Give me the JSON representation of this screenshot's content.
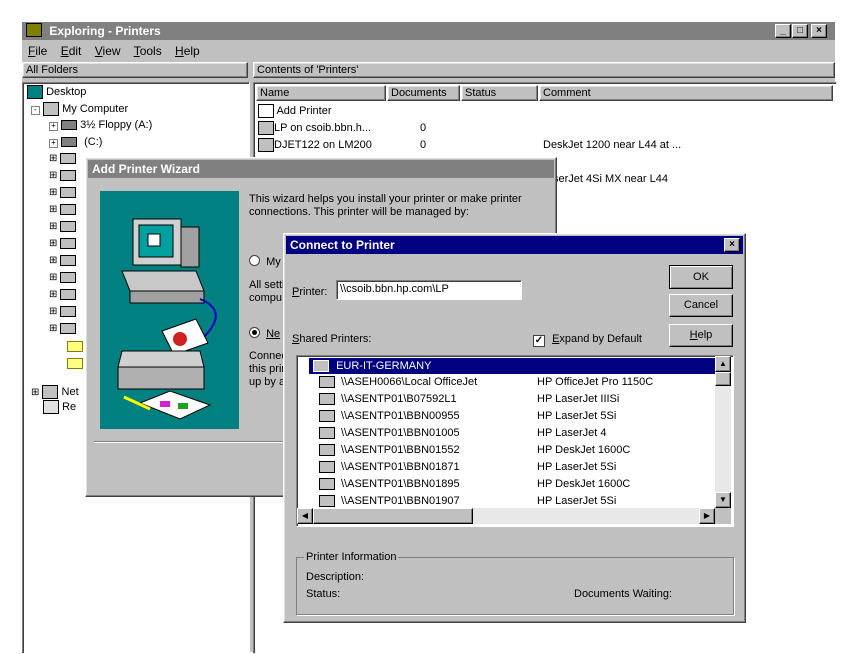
{
  "explorer": {
    "title": "Exploring - Printers",
    "menu": [
      "File",
      "Edit",
      "View",
      "Tools",
      "Help"
    ],
    "left_header": "All Folders",
    "right_header": "Contents of 'Printers'",
    "tree": [
      {
        "label": "Desktop",
        "icon": "desktop-icon"
      },
      {
        "label": "My Computer",
        "icon": "computer-icon"
      },
      {
        "label": "3½ Floppy (A:)",
        "icon": "floppy-icon"
      },
      {
        "label": "(C:)",
        "icon": "drive-icon"
      },
      {
        "label": "Net",
        "icon": "network-icon"
      },
      {
        "label": "Re",
        "icon": "recycle-icon"
      }
    ],
    "columns": [
      "Name",
      "Documents",
      "Status",
      "Comment"
    ],
    "files": [
      {
        "name": "Add Printer",
        "docs": "",
        "status": "",
        "comment": ""
      },
      {
        "name": "LP on csoib.bbn.h...",
        "docs": "0",
        "status": "",
        "comment": ""
      },
      {
        "name": "DJET122 on LM200",
        "docs": "0",
        "status": "",
        "comment": "DeskJet 1200 near L44 at ..."
      },
      {
        "name": "",
        "docs": "",
        "status": "",
        "comment": "serJet 4Si MX near L44"
      }
    ]
  },
  "wizard": {
    "title": "Add Printer Wizard",
    "intro": "This wizard helps you install your printer or make printer connections.  This printer will be managed by:",
    "option1": "My",
    "text2a": "All setti",
    "text2b": "compu",
    "option2": "Ne",
    "text3a": "Connec",
    "text3b": "this prin",
    "text3c": "up by a"
  },
  "connect": {
    "title": "Connect to Printer",
    "printer_label": "Printer:",
    "printer_value": "\\\\csoib.bbn.hp.com\\LP",
    "ok": "OK",
    "cancel": "Cancel",
    "help": "Help",
    "shared_label": "Shared Printers:",
    "expand_label": "Expand by Default",
    "expand_checked": true,
    "group": "EUR-IT-GERMANY",
    "printers": [
      {
        "path": "\\\\ASEH0066\\Local OfficeJet",
        "model": "HP OfficeJet Pro 1150C"
      },
      {
        "path": "\\\\ASENTP01\\B07592L1",
        "model": "HP LaserJet IIISi"
      },
      {
        "path": "\\\\ASENTP01\\BBN00955",
        "model": "HP LaserJet 5Si"
      },
      {
        "path": "\\\\ASENTP01\\BBN01005",
        "model": "HP LaserJet 4"
      },
      {
        "path": "\\\\ASENTP01\\BBN01552",
        "model": "HP DeskJet 1600C"
      },
      {
        "path": "\\\\ASENTP01\\BBN01871",
        "model": "HP LaserJet 5Si"
      },
      {
        "path": "\\\\ASENTP01\\BBN01895",
        "model": "HP DeskJet 1600C"
      },
      {
        "path": "\\\\ASENTP01\\BBN01907",
        "model": "HP LaserJet 5Si"
      }
    ],
    "info_title": "Printer Information",
    "description_label": "Description:",
    "status_label": "Status:",
    "docs_waiting_label": "Documents Waiting:"
  },
  "colors": {
    "title_active": "#000080",
    "title_inactive": "#808080",
    "face": "#c0c0c0",
    "wizard_teal": "#008080"
  }
}
